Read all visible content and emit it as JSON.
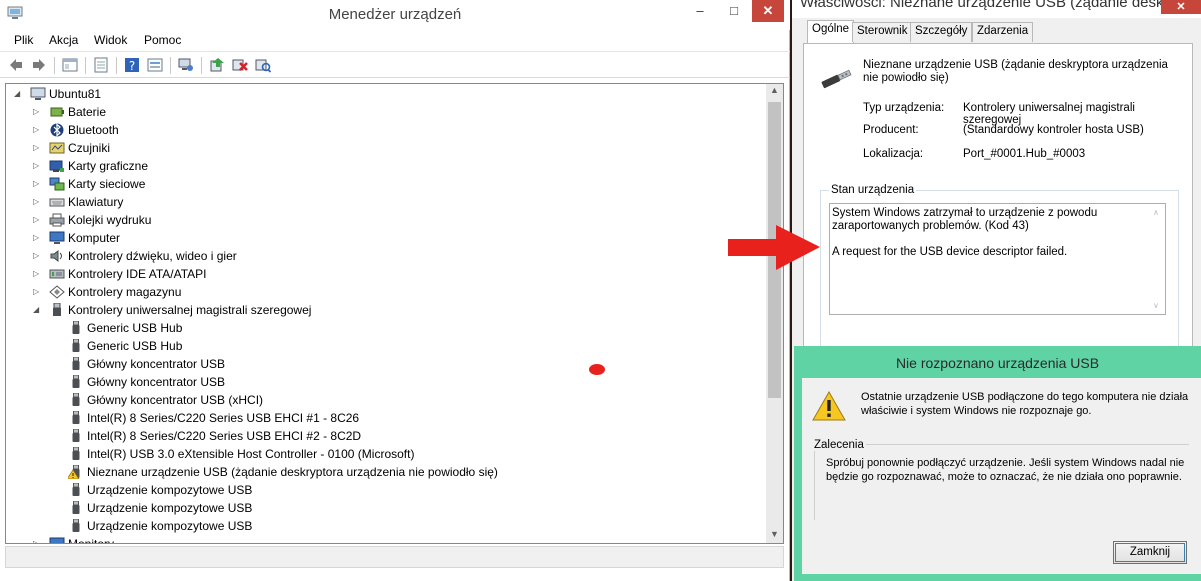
{
  "device_manager": {
    "title": "Menedżer urządzeń",
    "menu": [
      "Plik",
      "Akcja",
      "Widok",
      "Pomoc"
    ],
    "toolbar_icons": [
      "back-icon",
      "forward-icon",
      "show-hide-tree-icon",
      "properties-icon",
      "help-icon",
      "view-icon",
      "monitor-icon",
      "update-driver-icon",
      "uninstall-icon",
      "scan-hardware-icon"
    ],
    "tree": {
      "root": "Ubuntu81",
      "categories": [
        {
          "label": "Baterie",
          "icon": "battery-icon"
        },
        {
          "label": "Bluetooth",
          "icon": "bluetooth-icon"
        },
        {
          "label": "Czujniki",
          "icon": "sensor-icon"
        },
        {
          "label": "Karty graficzne",
          "icon": "display-adapter-icon"
        },
        {
          "label": "Karty sieciowe",
          "icon": "network-adapter-icon"
        },
        {
          "label": "Klawiatury",
          "icon": "keyboard-icon"
        },
        {
          "label": "Kolejki wydruku",
          "icon": "printer-icon"
        },
        {
          "label": "Komputer",
          "icon": "computer-icon"
        },
        {
          "label": "Kontrolery dźwięku, wideo i gier",
          "icon": "speaker-icon"
        },
        {
          "label": "Kontrolery IDE ATA/ATAPI",
          "icon": "ide-icon"
        },
        {
          "label": "Kontrolery magazynu",
          "icon": "storage-icon"
        },
        {
          "label": "Kontrolery uniwersalnej magistrali szeregowej",
          "icon": "usb-icon"
        }
      ],
      "usb_children": [
        {
          "label": "Generic USB Hub",
          "warning": false
        },
        {
          "label": "Generic USB Hub",
          "warning": false
        },
        {
          "label": "Główny koncentrator USB",
          "warning": false
        },
        {
          "label": "Główny koncentrator USB",
          "warning": false
        },
        {
          "label": "Główny koncentrator USB (xHCI)",
          "warning": false
        },
        {
          "label": "Intel(R) 8 Series/C220 Series USB EHCI #1 - 8C26",
          "warning": false
        },
        {
          "label": "Intel(R) 8 Series/C220 Series USB EHCI #2 - 8C2D",
          "warning": false
        },
        {
          "label": "Intel(R) USB 3.0 eXtensible Host Controller - 0100 (Microsoft)",
          "warning": false
        },
        {
          "label": "Nieznane urządzenie USB (żądanie deskryptora urządzenia nie powiodło się)",
          "warning": true
        },
        {
          "label": "Urządzenie kompozytowe USB",
          "warning": false
        },
        {
          "label": "Urządzenie kompozytowe USB",
          "warning": false
        },
        {
          "label": "Urządzenie kompozytowe USB",
          "warning": false
        }
      ],
      "last_category": "Monitory"
    }
  },
  "properties": {
    "title": "Właściwości: Nieznane urządzenie USB (żądanie deskr...",
    "tabs": [
      "Ogólne",
      "Sterownik",
      "Szczegóły",
      "Zdarzenia"
    ],
    "device_name": "Nieznane urządzenie USB (żądanie deskryptora urządzenia nie powiodło się)",
    "fields": [
      {
        "label": "Typ urządzenia:",
        "value": "Kontrolery uniwersalnej magistrali szeregowej"
      },
      {
        "label": "Producent:",
        "value": "(Standardowy kontroler hosta USB)"
      },
      {
        "label": "Lokalizacja:",
        "value": "Port_#0001.Hub_#0003"
      }
    ],
    "status_legend": "Stan urządzenia",
    "status_line1": "System Windows zatrzymał to urządzenie z powodu zaraportowanych problemów. (Kod 43)",
    "status_line2": "A request for the USB device descriptor failed."
  },
  "notification": {
    "title": "Nie rozpoznano urządzenia USB",
    "message": "Ostatnie urządzenie USB podłączone do tego komputera nie działa właściwie i system Windows nie rozpoznaje go.",
    "recommendations_legend": "Zalecenia",
    "recommendations_text": "Spróbuj ponownie podłączyć urządzenie. Jeśli system Windows nadal nie będzie go rozpoznawać, może to oznaczać, że nie działa ono poprawnie.",
    "close_label": "Zamknij"
  },
  "colors": {
    "annotation_red": "#e8211c",
    "notification_accent": "#60d3a5",
    "close_button": "#c7463c"
  }
}
